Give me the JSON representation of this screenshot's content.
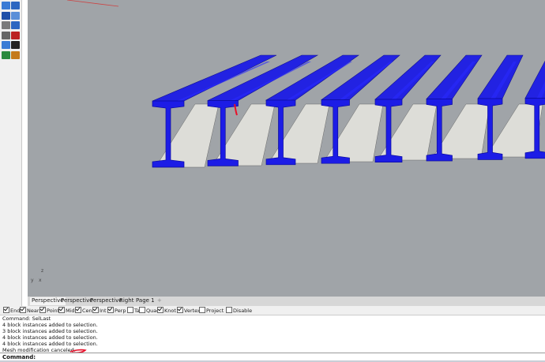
{
  "viewport_tabs": [
    "Perspective",
    "Perspective",
    "Perspective",
    "Right",
    "Page 1"
  ],
  "add_tab_glyph": "+",
  "axes": {
    "z": "z",
    "x": "x",
    "y": "y"
  },
  "osnaps": [
    {
      "label": "End",
      "checked": true
    },
    {
      "label": "Near",
      "checked": true
    },
    {
      "label": "Point",
      "checked": true
    },
    {
      "label": "Mid",
      "checked": true
    },
    {
      "label": "Cen",
      "checked": true
    },
    {
      "label": "Int",
      "checked": true
    },
    {
      "label": "Perp",
      "checked": true
    },
    {
      "label": "Tan",
      "checked": false
    },
    {
      "label": "Quad",
      "checked": false
    },
    {
      "label": "Knot",
      "checked": true
    },
    {
      "label": "Vertex",
      "checked": true
    },
    {
      "label": "Project",
      "checked": false
    },
    {
      "label": "Disable",
      "checked": false
    }
  ],
  "history": [
    "Command: SelLast",
    "4 block instances added to selection.",
    "3 block instances added to selection.",
    "4 block instances added to selection.",
    "4 block instances added to selection.",
    "Mesh modification canceled."
  ],
  "command_prompt": "Command:",
  "colors": {
    "beam": "#1c1ce6",
    "viewport": "#a0a4a8",
    "annotation": "#e8102a"
  },
  "toolbar_icons": [
    "select-icon",
    "lasso-icon",
    "sphere-icon",
    "box-icon",
    "mesh-icon",
    "transform-icon",
    "grid-icon",
    "pin-icon",
    "layer-icon",
    "check-icon",
    "render-icon",
    "pencil-icon"
  ]
}
